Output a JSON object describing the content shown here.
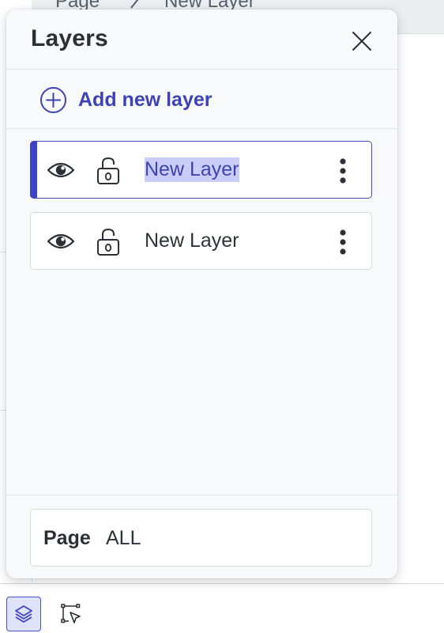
{
  "background": {
    "breadcrumb": [
      "Page",
      "New Layer"
    ],
    "breadcrumb_separator_icon": "chevron-right-icon"
  },
  "panel": {
    "title": "Layers",
    "close_icon": "close-icon",
    "add_button": {
      "label": "Add new layer",
      "icon": "plus-circle-icon"
    },
    "layers": [
      {
        "name": "New Layer",
        "visible": true,
        "locked": false,
        "selected": true,
        "name_highlighted": true
      },
      {
        "name": "New Layer",
        "visible": true,
        "locked": false,
        "selected": false,
        "name_highlighted": false
      }
    ],
    "footer": {
      "page_label": "Page",
      "page_value": "ALL"
    }
  },
  "toolbar": {
    "tools": [
      {
        "name": "layers-tool",
        "icon": "layers-icon",
        "active": true
      },
      {
        "name": "select-tool",
        "icon": "select-frame-icon",
        "active": false
      }
    ]
  },
  "colors": {
    "accent": "#3f44c2",
    "accent_text": "#3d43b4",
    "highlight": "#c9cdf8",
    "panel_bg": "#f8f9fb"
  }
}
